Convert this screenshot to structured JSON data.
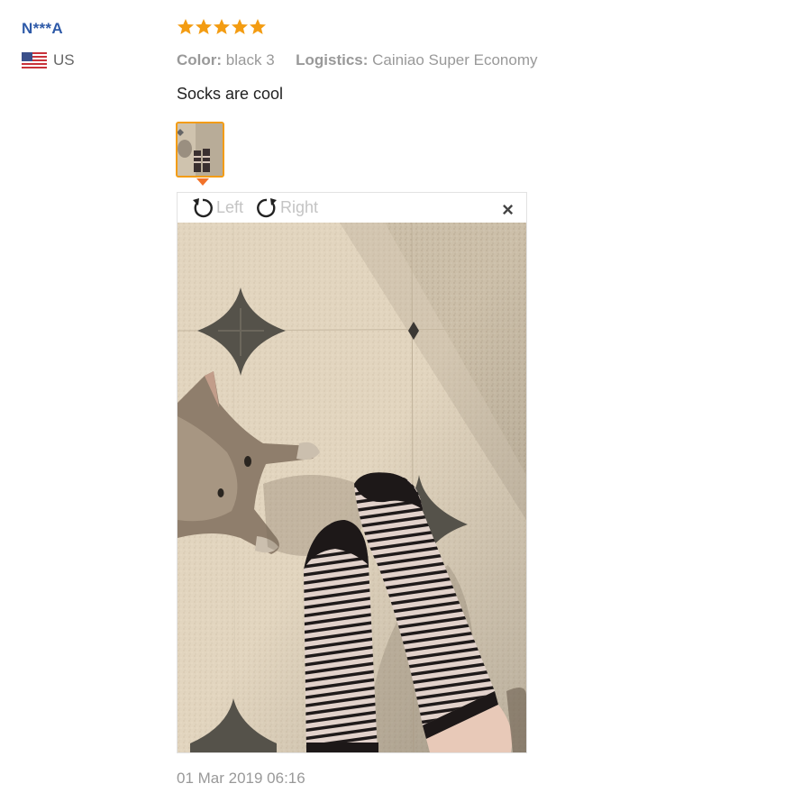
{
  "reviewer": {
    "name": "N***A",
    "country": "US"
  },
  "review": {
    "rating": 5,
    "meta": {
      "color_label": "Color:",
      "color_value": "black 3",
      "logistics_label": "Logistics:",
      "logistics_value": "Cainiao Super Economy"
    },
    "text": "Socks are cool",
    "date": "01 Mar 2019 06:16"
  },
  "viewer": {
    "rotate_left": "Left",
    "rotate_right": "Right",
    "close": "×"
  },
  "colors": {
    "star": "#f39c12",
    "username": "#2e5aa8",
    "thumb_border": "#f39c12",
    "arrow": "#f2722a"
  },
  "icons": [
    "us-flag-icon",
    "star-icon",
    "rotate-left-icon",
    "rotate-right-icon",
    "close-icon"
  ]
}
